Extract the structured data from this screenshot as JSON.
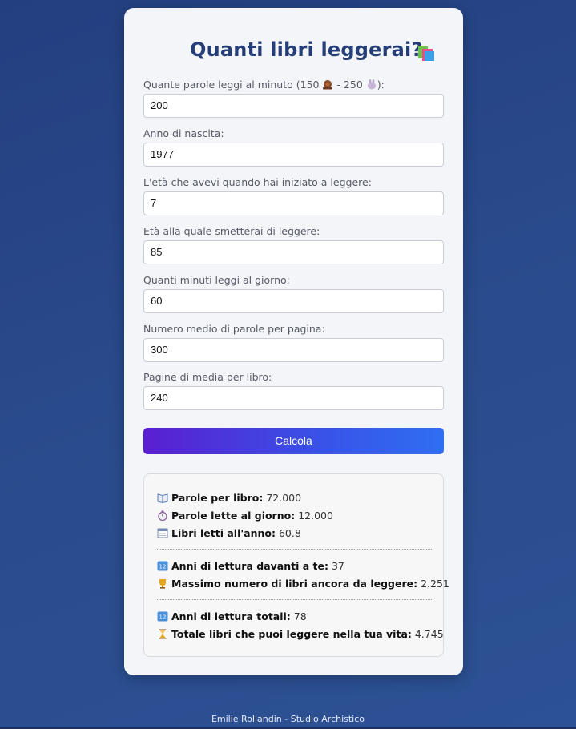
{
  "title": "Quanti libri leggerai?",
  "fields": [
    {
      "label_pre": "Quante parole leggi al minuto (150 ",
      "label_mid": " - 250 ",
      "label_post": "):",
      "value": "200"
    },
    {
      "label": "Anno di nascita:",
      "value": "1977"
    },
    {
      "label": "L'età che avevi quando hai iniziato a leggere:",
      "value": "7"
    },
    {
      "label": "Età alla quale smetterai di leggere:",
      "value": "85"
    },
    {
      "label": "Quanti minuti leggi al giorno:",
      "value": "60"
    },
    {
      "label": "Numero medio di parole per pagina:",
      "value": "300"
    },
    {
      "label": "Pagine di media per libro:",
      "value": "240"
    }
  ],
  "button": {
    "label": "Calcola"
  },
  "results": {
    "group1": [
      {
        "icon": "open-book-icon",
        "label": "Parole per libro:",
        "value": "72.000"
      },
      {
        "icon": "stopwatch-icon",
        "label": "Parole lette al giorno:",
        "value": "12.000"
      },
      {
        "icon": "calendar-icon",
        "label": "Libri letti all'anno:",
        "value": "60.8"
      }
    ],
    "group2": [
      {
        "icon": "numbers-icon",
        "label": "Anni di lettura davanti a te:",
        "value": "37"
      },
      {
        "icon": "trophy-icon",
        "label": "Massimo numero di libri ancora da leggere:",
        "value": "2.251"
      }
    ],
    "group3": [
      {
        "icon": "numbers-icon",
        "label": "Anni di lettura totali:",
        "value": "78"
      },
      {
        "icon": "hourglass-icon",
        "label": "Totale libri che puoi leggere nella tua vita:",
        "value": "4.745"
      }
    ]
  },
  "footer": "Emilie Rollandin - Studio Archistico",
  "colors": {
    "title": "#253e78",
    "button_start": "#5b1ed0",
    "button_end": "#2f6ff2",
    "background": "#2a4c8e"
  }
}
